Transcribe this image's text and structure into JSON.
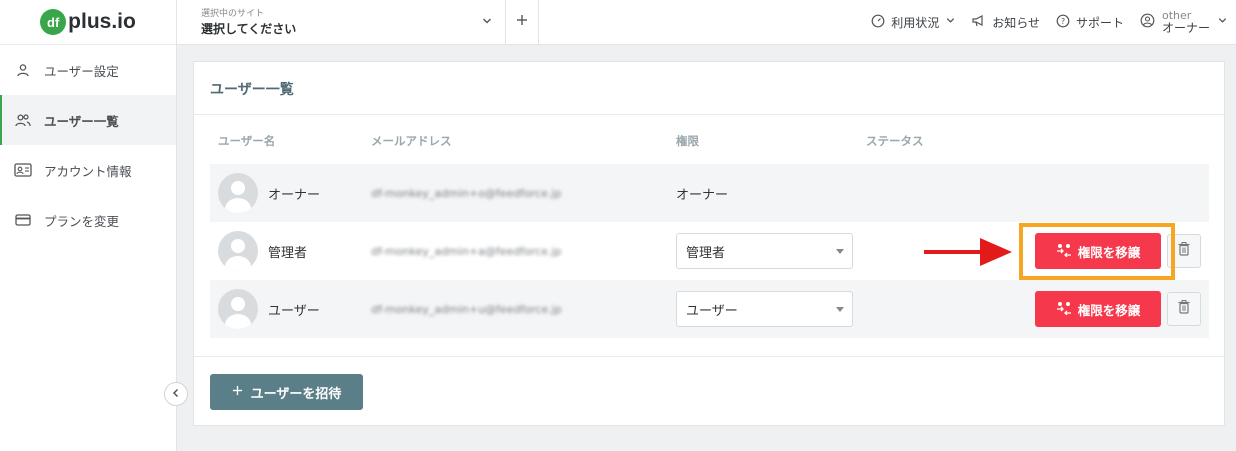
{
  "brand": {
    "logo_mark": "df",
    "logo_text": "plus.io",
    "accent": "#3aa64a"
  },
  "sidebar": {
    "items": [
      {
        "label": "ユーザー設定",
        "icon": "person-icon",
        "active": false
      },
      {
        "label": "ユーザー一覧",
        "icon": "users-icon",
        "active": true
      },
      {
        "label": "アカウント情報",
        "icon": "id-card-icon",
        "active": false
      },
      {
        "label": "プランを変更",
        "icon": "credit-card-icon",
        "active": false
      }
    ]
  },
  "topbar": {
    "site_caption": "選択中のサイト",
    "site_value": "選択してください",
    "usage_label": "利用状況",
    "notice_label": "お知らせ",
    "support_label": "サポート",
    "user_sub": "other",
    "user_role": "オーナー"
  },
  "page": {
    "title": "ユーザー一覧",
    "columns": {
      "name": "ユーザー名",
      "email": "メールアドレス",
      "role": "権限",
      "status": "ステータス"
    },
    "users": [
      {
        "name": "オーナー",
        "email": "df-monkey_admin+o@feedforce.jp",
        "role": "オーナー"
      },
      {
        "name": "管理者",
        "email": "df-monkey_admin+a@feedforce.jp",
        "role": "管理者"
      },
      {
        "name": "ユーザー",
        "email": "df-monkey_admin+u@feedforce.jp",
        "role": "ユーザー"
      }
    ],
    "transfer_label": "権限を移譲",
    "invite_label": "ユーザーを招待"
  },
  "colors": {
    "danger": "#f5384b",
    "invite": "#5b7f88",
    "highlight": "#f5a623",
    "arrow": "#e31a1a"
  }
}
